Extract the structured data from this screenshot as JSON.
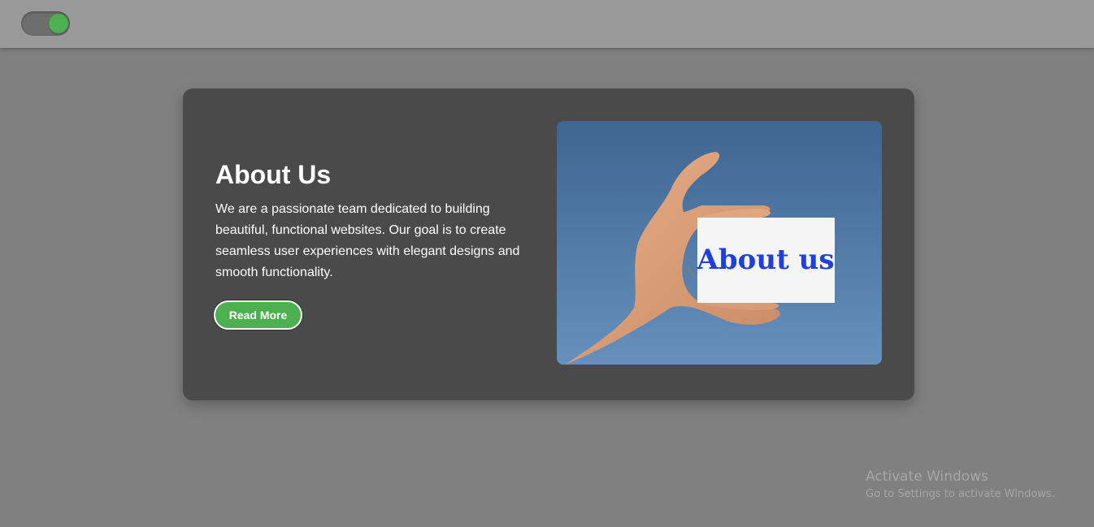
{
  "theme_toggle": {
    "state": "on",
    "knob_color": "#4caf50"
  },
  "about": {
    "title": "About Us",
    "description": "We are a passionate team dedicated to building beautiful, functional websites. Our goal is to create seamless user experiences with elegant designs and smooth functionality.",
    "button_label": "Read More",
    "image_card_text": "About us"
  },
  "colors": {
    "page_background": "#808080",
    "header_background": "#999999",
    "card_background": "#4a4a4a",
    "accent": "#4caf50",
    "card_text": "#1f3fe0"
  },
  "watermark": {
    "title": "Activate Windows",
    "subtitle": "Go to Settings to activate Windows."
  }
}
